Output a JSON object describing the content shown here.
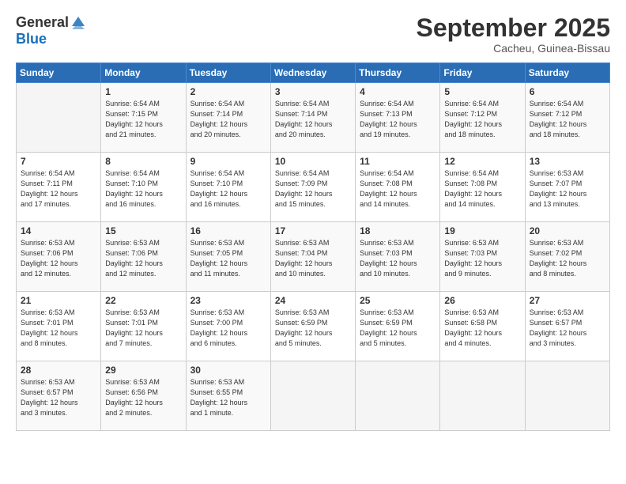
{
  "header": {
    "logo_general": "General",
    "logo_blue": "Blue",
    "month_title": "September 2025",
    "location": "Cacheu, Guinea-Bissau"
  },
  "columns": [
    "Sunday",
    "Monday",
    "Tuesday",
    "Wednesday",
    "Thursday",
    "Friday",
    "Saturday"
  ],
  "weeks": [
    [
      {
        "date": "",
        "info": ""
      },
      {
        "date": "1",
        "info": "Sunrise: 6:54 AM\nSunset: 7:15 PM\nDaylight: 12 hours\nand 21 minutes."
      },
      {
        "date": "2",
        "info": "Sunrise: 6:54 AM\nSunset: 7:14 PM\nDaylight: 12 hours\nand 20 minutes."
      },
      {
        "date": "3",
        "info": "Sunrise: 6:54 AM\nSunset: 7:14 PM\nDaylight: 12 hours\nand 20 minutes."
      },
      {
        "date": "4",
        "info": "Sunrise: 6:54 AM\nSunset: 7:13 PM\nDaylight: 12 hours\nand 19 minutes."
      },
      {
        "date": "5",
        "info": "Sunrise: 6:54 AM\nSunset: 7:12 PM\nDaylight: 12 hours\nand 18 minutes."
      },
      {
        "date": "6",
        "info": "Sunrise: 6:54 AM\nSunset: 7:12 PM\nDaylight: 12 hours\nand 18 minutes."
      }
    ],
    [
      {
        "date": "7",
        "info": "Sunrise: 6:54 AM\nSunset: 7:11 PM\nDaylight: 12 hours\nand 17 minutes."
      },
      {
        "date": "8",
        "info": "Sunrise: 6:54 AM\nSunset: 7:10 PM\nDaylight: 12 hours\nand 16 minutes."
      },
      {
        "date": "9",
        "info": "Sunrise: 6:54 AM\nSunset: 7:10 PM\nDaylight: 12 hours\nand 16 minutes."
      },
      {
        "date": "10",
        "info": "Sunrise: 6:54 AM\nSunset: 7:09 PM\nDaylight: 12 hours\nand 15 minutes."
      },
      {
        "date": "11",
        "info": "Sunrise: 6:54 AM\nSunset: 7:08 PM\nDaylight: 12 hours\nand 14 minutes."
      },
      {
        "date": "12",
        "info": "Sunrise: 6:54 AM\nSunset: 7:08 PM\nDaylight: 12 hours\nand 14 minutes."
      },
      {
        "date": "13",
        "info": "Sunrise: 6:53 AM\nSunset: 7:07 PM\nDaylight: 12 hours\nand 13 minutes."
      }
    ],
    [
      {
        "date": "14",
        "info": "Sunrise: 6:53 AM\nSunset: 7:06 PM\nDaylight: 12 hours\nand 12 minutes."
      },
      {
        "date": "15",
        "info": "Sunrise: 6:53 AM\nSunset: 7:06 PM\nDaylight: 12 hours\nand 12 minutes."
      },
      {
        "date": "16",
        "info": "Sunrise: 6:53 AM\nSunset: 7:05 PM\nDaylight: 12 hours\nand 11 minutes."
      },
      {
        "date": "17",
        "info": "Sunrise: 6:53 AM\nSunset: 7:04 PM\nDaylight: 12 hours\nand 10 minutes."
      },
      {
        "date": "18",
        "info": "Sunrise: 6:53 AM\nSunset: 7:03 PM\nDaylight: 12 hours\nand 10 minutes."
      },
      {
        "date": "19",
        "info": "Sunrise: 6:53 AM\nSunset: 7:03 PM\nDaylight: 12 hours\nand 9 minutes."
      },
      {
        "date": "20",
        "info": "Sunrise: 6:53 AM\nSunset: 7:02 PM\nDaylight: 12 hours\nand 8 minutes."
      }
    ],
    [
      {
        "date": "21",
        "info": "Sunrise: 6:53 AM\nSunset: 7:01 PM\nDaylight: 12 hours\nand 8 minutes."
      },
      {
        "date": "22",
        "info": "Sunrise: 6:53 AM\nSunset: 7:01 PM\nDaylight: 12 hours\nand 7 minutes."
      },
      {
        "date": "23",
        "info": "Sunrise: 6:53 AM\nSunset: 7:00 PM\nDaylight: 12 hours\nand 6 minutes."
      },
      {
        "date": "24",
        "info": "Sunrise: 6:53 AM\nSunset: 6:59 PM\nDaylight: 12 hours\nand 5 minutes."
      },
      {
        "date": "25",
        "info": "Sunrise: 6:53 AM\nSunset: 6:59 PM\nDaylight: 12 hours\nand 5 minutes."
      },
      {
        "date": "26",
        "info": "Sunrise: 6:53 AM\nSunset: 6:58 PM\nDaylight: 12 hours\nand 4 minutes."
      },
      {
        "date": "27",
        "info": "Sunrise: 6:53 AM\nSunset: 6:57 PM\nDaylight: 12 hours\nand 3 minutes."
      }
    ],
    [
      {
        "date": "28",
        "info": "Sunrise: 6:53 AM\nSunset: 6:57 PM\nDaylight: 12 hours\nand 3 minutes."
      },
      {
        "date": "29",
        "info": "Sunrise: 6:53 AM\nSunset: 6:56 PM\nDaylight: 12 hours\nand 2 minutes."
      },
      {
        "date": "30",
        "info": "Sunrise: 6:53 AM\nSunset: 6:55 PM\nDaylight: 12 hours\nand 1 minute."
      },
      {
        "date": "",
        "info": ""
      },
      {
        "date": "",
        "info": ""
      },
      {
        "date": "",
        "info": ""
      },
      {
        "date": "",
        "info": ""
      }
    ]
  ]
}
